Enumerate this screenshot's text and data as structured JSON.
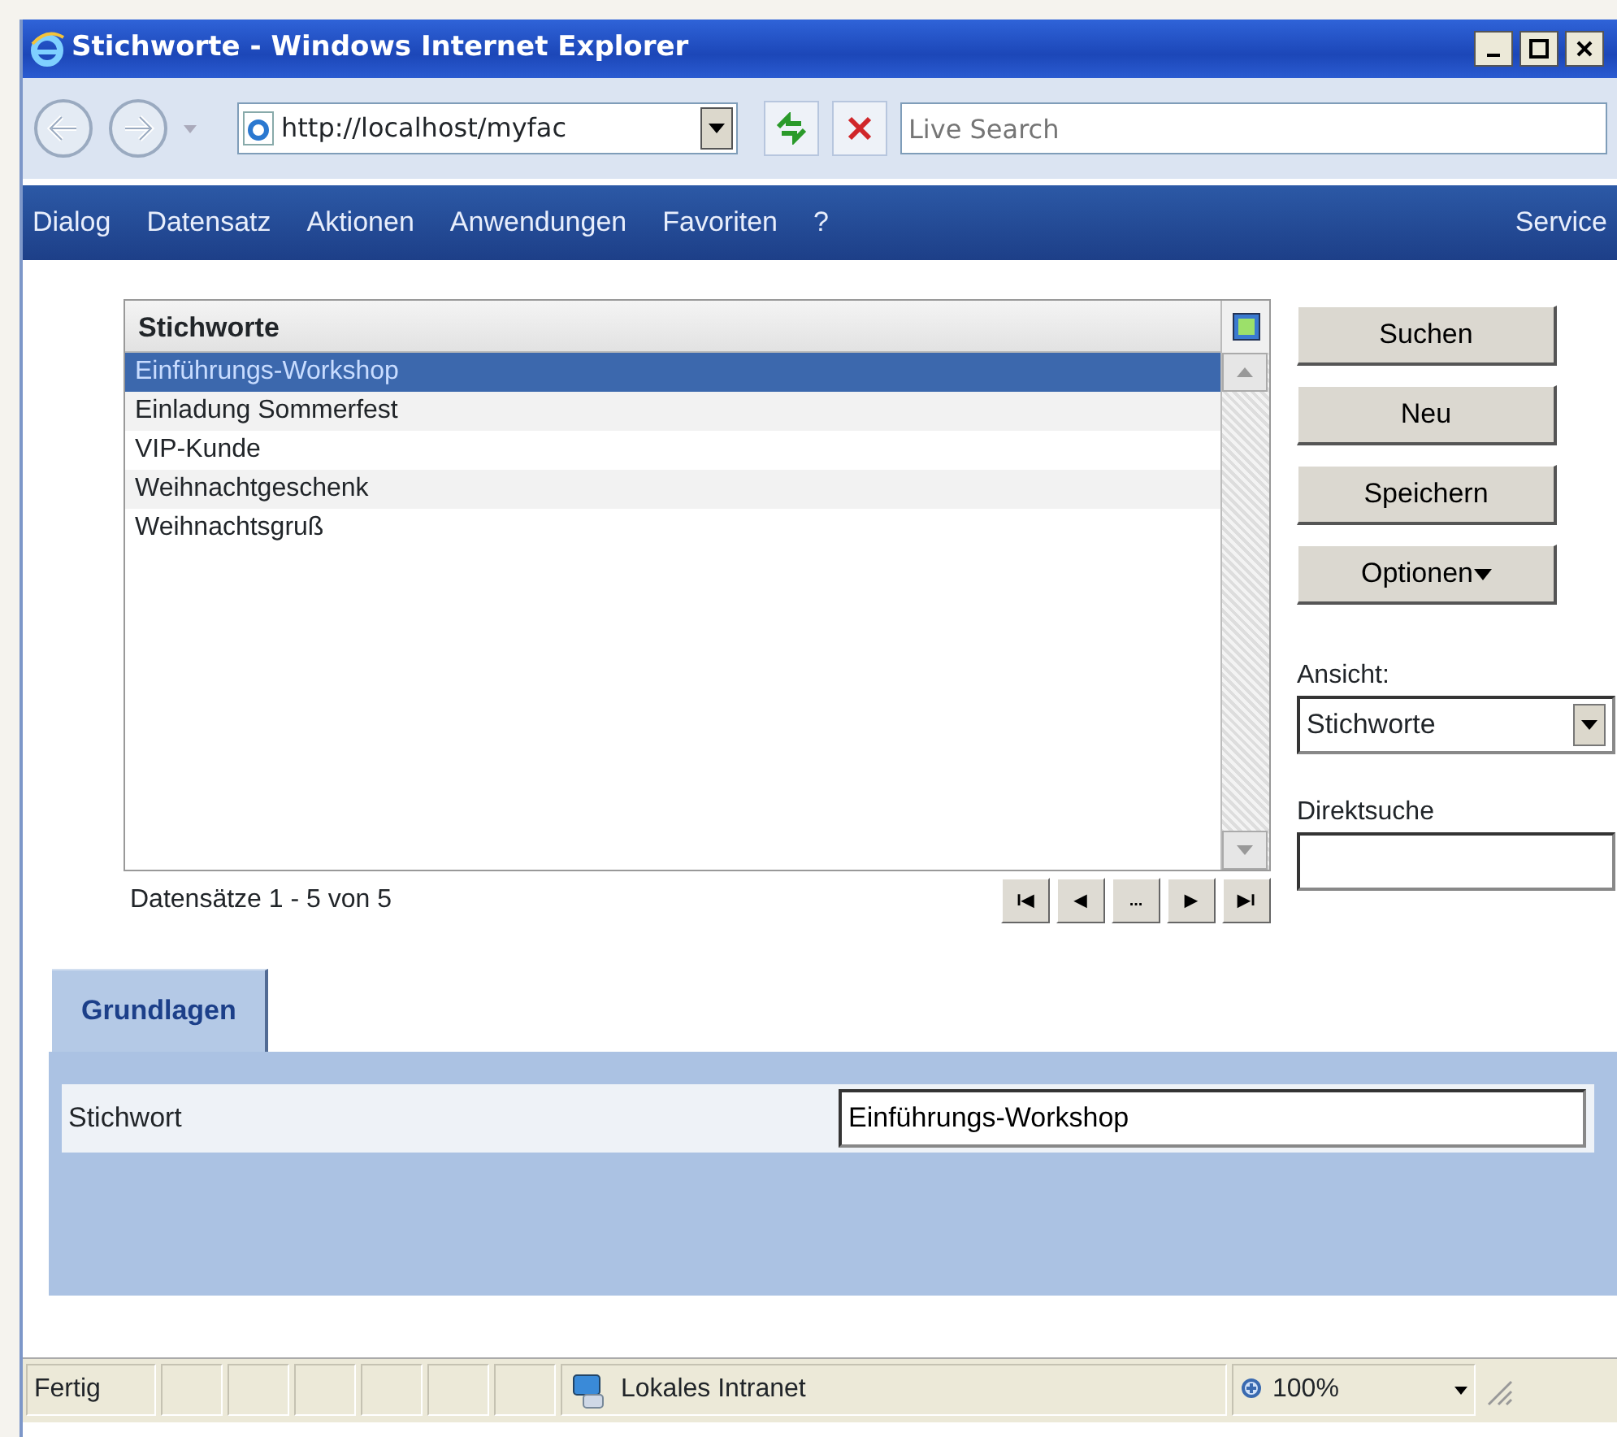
{
  "window": {
    "title": "Stichworte - Windows Internet Explorer"
  },
  "address": {
    "value": "http://localhost/myfac"
  },
  "search": {
    "placeholder": "Live Search"
  },
  "menu": [
    {
      "label": "Dialog"
    },
    {
      "label": "Datensatz"
    },
    {
      "label": "Aktionen"
    },
    {
      "label": "Anwendungen"
    },
    {
      "label": "Favoriten"
    },
    {
      "label": "?"
    }
  ],
  "menu_right": "Service",
  "list": {
    "header": "Stichworte",
    "rows": [
      {
        "label": "Einführungs-Workshop",
        "selected": true
      },
      {
        "label": "Einladung Sommerfest",
        "selected": false
      },
      {
        "label": "VIP-Kunde",
        "selected": false
      },
      {
        "label": "Weihnachtgeschenk",
        "selected": false
      },
      {
        "label": "Weihnachtsgruß",
        "selected": false
      }
    ],
    "footer": "Datensätze 1 - 5 von 5",
    "pager": [
      "I◀",
      "◀",
      "...",
      "▶",
      "▶I"
    ]
  },
  "buttons": [
    {
      "label": "Suchen",
      "dropdown": false
    },
    {
      "label": "Neu",
      "dropdown": false
    },
    {
      "label": "Speichern",
      "dropdown": false
    },
    {
      "label": "Optionen",
      "dropdown": true
    }
  ],
  "view": {
    "label": "Ansicht:",
    "value": "Stichworte"
  },
  "direct_search": {
    "label": "Direktsuche"
  },
  "tabs": [
    {
      "label": "Grundlagen",
      "selected": true
    }
  ],
  "form": [
    {
      "label": "Stichwort",
      "value": "Einführungs-Workshop"
    }
  ],
  "status_bar": {
    "text": "Fertig",
    "zone": "Lokales Intranet",
    "zoom": "100%"
  }
}
